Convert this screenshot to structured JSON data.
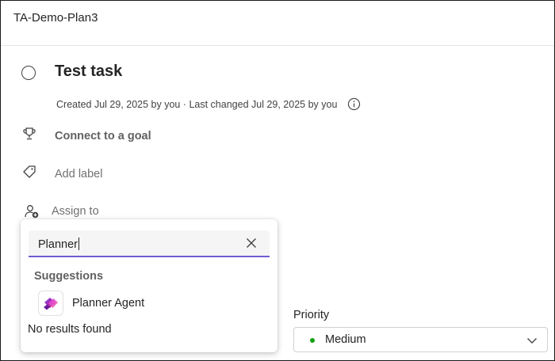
{
  "header": {
    "plan_name": "TA-Demo-Plan3"
  },
  "task": {
    "title": "Test task",
    "meta": "Created Jul 29, 2025 by you · Last changed Jul 29, 2025 by you"
  },
  "fields": {
    "goal_label": "Connect to a goal",
    "label_placeholder": "Add label",
    "assign_placeholder": "Assign to"
  },
  "assign_popup": {
    "search_value": "Planner",
    "suggestions_header": "Suggestions",
    "suggestions": [
      {
        "name": "Planner Agent"
      }
    ],
    "no_results": "No results found"
  },
  "priority": {
    "label": "Priority",
    "value": "Medium",
    "color": "#13a10e"
  },
  "icons": [
    "circle-check-icon",
    "info-icon",
    "trophy-icon",
    "tag-icon",
    "person-add-icon",
    "close-icon",
    "planner-agent-icon",
    "chevron-down-icon"
  ]
}
